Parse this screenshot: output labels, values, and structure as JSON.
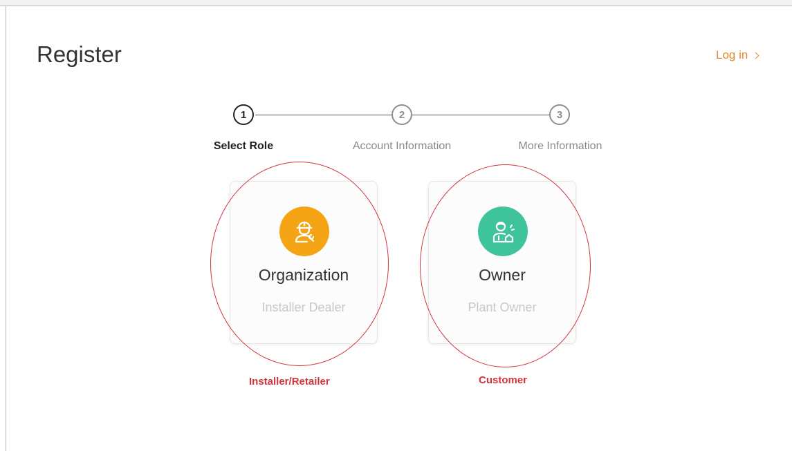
{
  "header": {
    "title": "Register",
    "login_label": "Log in"
  },
  "steps": [
    {
      "number": "1",
      "label": "Select Role",
      "state": "active"
    },
    {
      "number": "2",
      "label": "Account Information",
      "state": "inactive"
    },
    {
      "number": "3",
      "label": "More Information",
      "state": "inactive"
    }
  ],
  "roles": [
    {
      "name": "Organization",
      "description": "Installer Dealer",
      "icon": "installer-worker-icon",
      "color": "#f5a416"
    },
    {
      "name": "Owner",
      "description": "Plant Owner",
      "icon": "owner-person-icon",
      "color": "#3ec39a"
    }
  ],
  "annotations": [
    {
      "text": "Installer/Retailer",
      "color": "#d0353b"
    },
    {
      "text": "Customer",
      "color": "#d0353b"
    }
  ]
}
